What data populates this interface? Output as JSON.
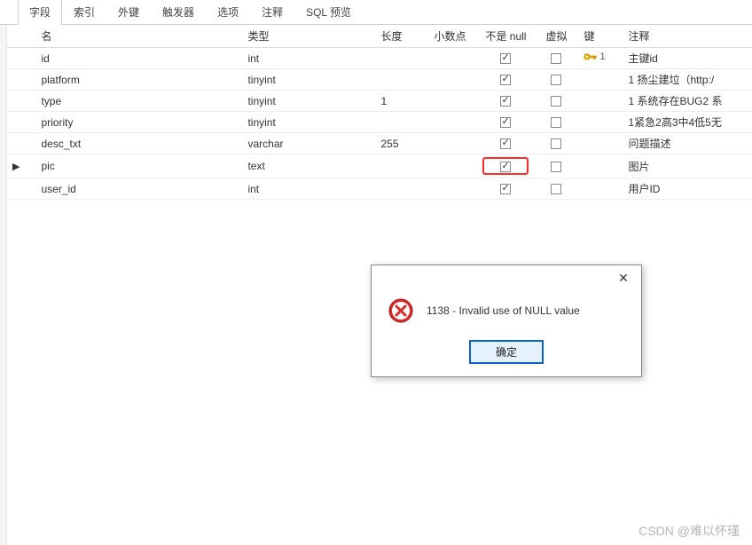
{
  "tabs": {
    "fields": "字段",
    "indexes": "索引",
    "foreign_keys": "外键",
    "triggers": "触发器",
    "options": "选项",
    "comments": "注释",
    "sql_preview": "SQL 预览"
  },
  "headers": {
    "name": "名",
    "type": "类型",
    "length": "长度",
    "decimal": "小数点",
    "not_null": "不是 null",
    "virtual": "虚拟",
    "key": "键",
    "comment": "注释"
  },
  "rows": [
    {
      "name": "id",
      "type": "int",
      "length": "",
      "not_null": true,
      "virtual": false,
      "key": "1",
      "comment": "主键id",
      "active": false
    },
    {
      "name": "platform",
      "type": "tinyint",
      "length": "",
      "not_null": true,
      "virtual": false,
      "key": "",
      "comment": "1 扬尘建垃（http:/",
      "active": false
    },
    {
      "name": "type",
      "type": "tinyint",
      "length": "1",
      "not_null": true,
      "virtual": false,
      "key": "",
      "comment": "1 系统存在BUG2 系",
      "active": false
    },
    {
      "name": "priority",
      "type": "tinyint",
      "length": "",
      "not_null": true,
      "virtual": false,
      "key": "",
      "comment": "1紧急2高3中4低5无",
      "active": false
    },
    {
      "name": "desc_txt",
      "type": "varchar",
      "length": "255",
      "not_null": true,
      "virtual": false,
      "key": "",
      "comment": "问题描述",
      "active": false
    },
    {
      "name": "pic",
      "type": "text",
      "length": "",
      "not_null": true,
      "virtual": false,
      "key": "",
      "comment": "图片",
      "active": true,
      "highlight": true
    },
    {
      "name": "user_id",
      "type": "int",
      "length": "",
      "not_null": true,
      "virtual": false,
      "key": "",
      "comment": "用户ID",
      "active": false
    }
  ],
  "dialog": {
    "message": "1138 - Invalid use of NULL value",
    "ok": "确定",
    "close": "✕"
  },
  "watermark": "CSDN @难以怀瑾"
}
